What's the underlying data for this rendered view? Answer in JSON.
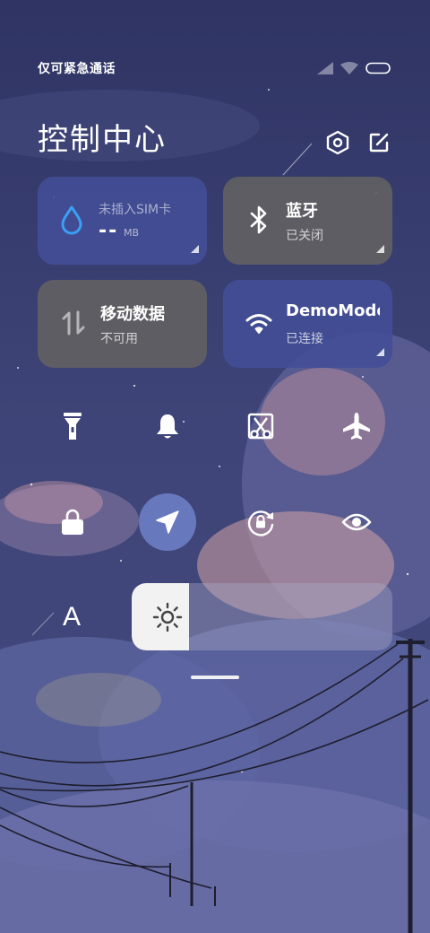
{
  "status_bar": {
    "carrier": "仅可紧急通话",
    "icons": [
      "signal-icon",
      "wifi-icon",
      "battery-icon"
    ]
  },
  "header": {
    "title": "控制中心",
    "settings_icon": "settings-hex-icon",
    "edit_icon": "edit-icon"
  },
  "tiles": {
    "data_usage": {
      "label": "未插入SIM卡",
      "value": "--",
      "unit": "MB",
      "icon": "water-drop-icon"
    },
    "bluetooth": {
      "name": "蓝牙",
      "status": "已关闭",
      "icon": "bluetooth-icon"
    },
    "mobile_data": {
      "name": "移动数据",
      "status": "不可用",
      "icon": "data-arrows-icon"
    },
    "wifi": {
      "name": "DemoMode",
      "status": "已连接",
      "icon": "wifi-icon"
    }
  },
  "quick_toggles": {
    "row1": [
      "flashlight-icon",
      "bell-icon",
      "screenshot-icon",
      "airplane-icon"
    ],
    "row2": [
      "lock-icon",
      "location-icon",
      "rotation-lock-icon",
      "eye-icon"
    ],
    "location_active": true
  },
  "bottom": {
    "font_button": "A",
    "brightness_level": 0.22,
    "brightness_icon": "sun-icon"
  },
  "colors": {
    "blue_tile": "#424e96",
    "gray_tile": "#606062",
    "active_toggle": "#6e82c8"
  }
}
